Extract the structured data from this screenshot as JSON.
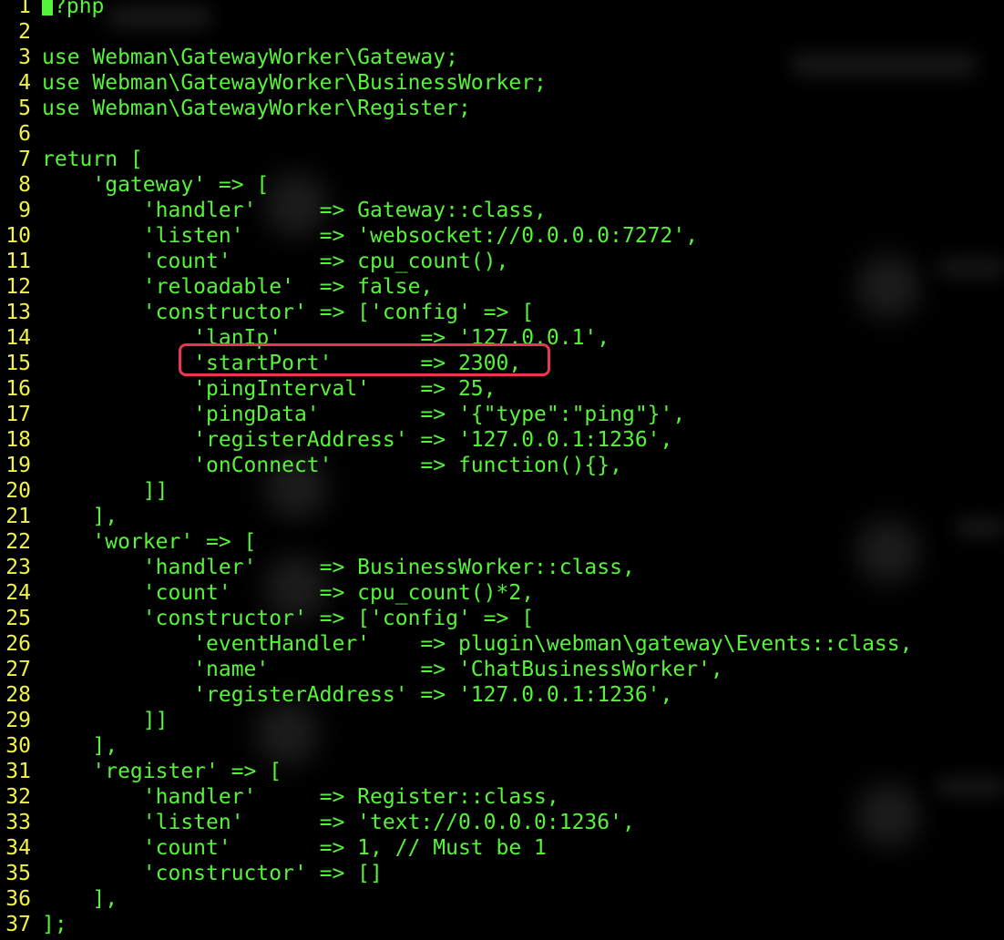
{
  "editor": {
    "cursor_line": 1,
    "highlight_line": 15,
    "highlight_color": "#e8384f",
    "line_number_color": "#f2f24a",
    "code_color": "#57f23a",
    "background": "#000000",
    "lines": [
      {
        "num": "1",
        "text": "?php"
      },
      {
        "num": "2",
        "text": ""
      },
      {
        "num": "3",
        "text": "use Webman\\GatewayWorker\\Gateway;"
      },
      {
        "num": "4",
        "text": "use Webman\\GatewayWorker\\BusinessWorker;"
      },
      {
        "num": "5",
        "text": "use Webman\\GatewayWorker\\Register;"
      },
      {
        "num": "6",
        "text": ""
      },
      {
        "num": "7",
        "text": "return ["
      },
      {
        "num": "8",
        "text": "    'gateway' => ["
      },
      {
        "num": "9",
        "text": "        'handler'     => Gateway::class,"
      },
      {
        "num": "10",
        "text": "        'listen'      => 'websocket://0.0.0.0:7272',"
      },
      {
        "num": "11",
        "text": "        'count'       => cpu_count(),"
      },
      {
        "num": "12",
        "text": "        'reloadable'  => false,"
      },
      {
        "num": "13",
        "text": "        'constructor' => ['config' => ["
      },
      {
        "num": "14",
        "text": "            'lanIp'           => '127.0.0.1',"
      },
      {
        "num": "15",
        "text": "            'startPort'       => 2300,"
      },
      {
        "num": "16",
        "text": "            'pingInterval'    => 25,"
      },
      {
        "num": "17",
        "text": "            'pingData'        => '{\"type\":\"ping\"}',"
      },
      {
        "num": "18",
        "text": "            'registerAddress' => '127.0.0.1:1236',"
      },
      {
        "num": "19",
        "text": "            'onConnect'       => function(){},"
      },
      {
        "num": "20",
        "text": "        ]]"
      },
      {
        "num": "21",
        "text": "    ],"
      },
      {
        "num": "22",
        "text": "    'worker' => ["
      },
      {
        "num": "23",
        "text": "        'handler'     => BusinessWorker::class,"
      },
      {
        "num": "24",
        "text": "        'count'       => cpu_count()*2,"
      },
      {
        "num": "25",
        "text": "        'constructor' => ['config' => ["
      },
      {
        "num": "26",
        "text": "            'eventHandler'    => plugin\\webman\\gateway\\Events::class,"
      },
      {
        "num": "27",
        "text": "            'name'            => 'ChatBusinessWorker',"
      },
      {
        "num": "28",
        "text": "            'registerAddress' => '127.0.0.1:1236',"
      },
      {
        "num": "29",
        "text": "        ]]"
      },
      {
        "num": "30",
        "text": "    ],"
      },
      {
        "num": "31",
        "text": "    'register' => ["
      },
      {
        "num": "32",
        "text": "        'handler'     => Register::class,"
      },
      {
        "num": "33",
        "text": "        'listen'      => 'text://0.0.0.0:1236',"
      },
      {
        "num": "34",
        "text": "        'count'       => 1, // Must be 1"
      },
      {
        "num": "35",
        "text": "        'constructor' => []"
      },
      {
        "num": "36",
        "text": "    ],"
      },
      {
        "num": "37",
        "text": "];"
      }
    ]
  }
}
